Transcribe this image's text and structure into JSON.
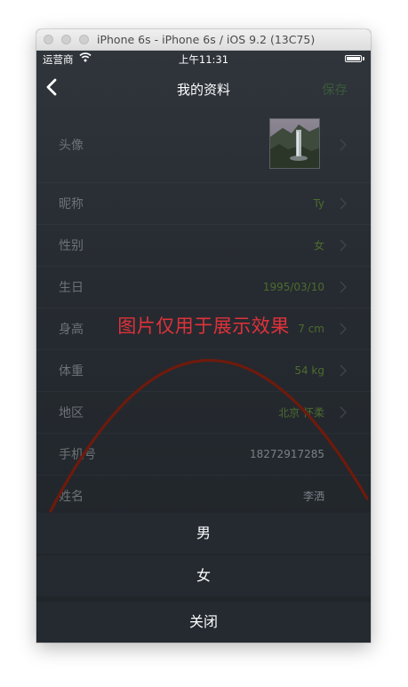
{
  "window": {
    "title": "iPhone 6s - iPhone 6s / iOS 9.2 (13C75)"
  },
  "status_bar": {
    "carrier": "运营商",
    "time": "上午11:31",
    "battery_level": 1.0
  },
  "nav": {
    "title": "我的资料",
    "save_label": "保存"
  },
  "profile": {
    "avatar_label": "头像",
    "rows": [
      {
        "label": "昵称",
        "value": "Ty"
      },
      {
        "label": "性别",
        "value": "女"
      },
      {
        "label": "生日",
        "value": "1995/03/10"
      },
      {
        "label": "身高",
        "value": "7 cm"
      },
      {
        "label": "体重",
        "value": "54 kg"
      },
      {
        "label": "地区",
        "value": "北京 怀柔"
      },
      {
        "label": "手机号",
        "value": "18272917285"
      },
      {
        "label": "姓名",
        "value": "李洒"
      }
    ]
  },
  "overlay": {
    "text": "图片仅用于展示效果"
  },
  "action_sheet": {
    "option_male": "男",
    "option_female": "女",
    "close": "关闭"
  },
  "colors": {
    "value_green": "#4d6b2e",
    "overlay_red": "#e0313a",
    "arc_red": "#6e1a0c"
  }
}
